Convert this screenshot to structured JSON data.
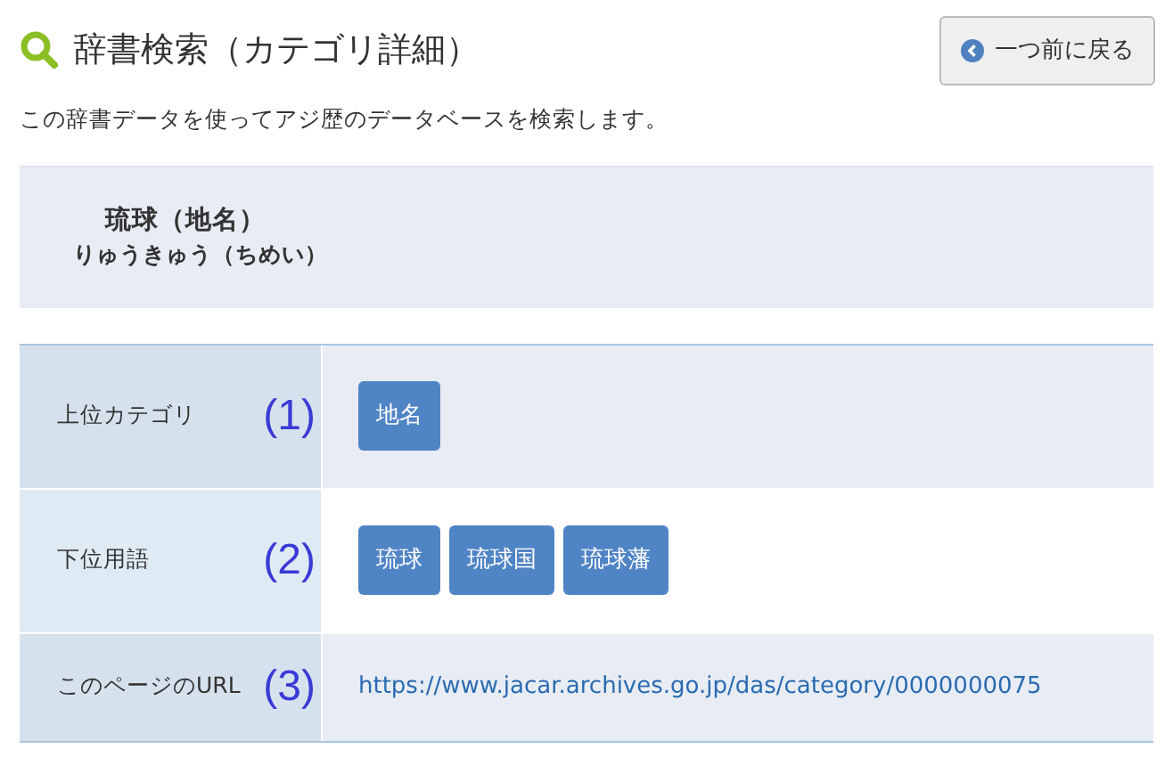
{
  "header": {
    "title": "辞書検索（カテゴリ詳細）",
    "back_button": "一つ前に戻る"
  },
  "description": "この辞書データを使ってアジ歴のデータベースを検索します。",
  "entry": {
    "name": "琉球（地名）",
    "reading": "りゅうきゅう（ちめい）"
  },
  "rows": [
    {
      "label": "上位カテゴリ",
      "marker": "(1)",
      "kind": "tags",
      "tags": [
        "地名"
      ]
    },
    {
      "label": "下位用語",
      "marker": "(2)",
      "kind": "tags",
      "tags": [
        "琉球",
        "琉球国",
        "琉球藩"
      ]
    },
    {
      "label": "このページのURL",
      "marker": "(3)",
      "kind": "link",
      "link": "https://www.jacar.archives.go.jp/das/category/0000000075"
    }
  ]
}
